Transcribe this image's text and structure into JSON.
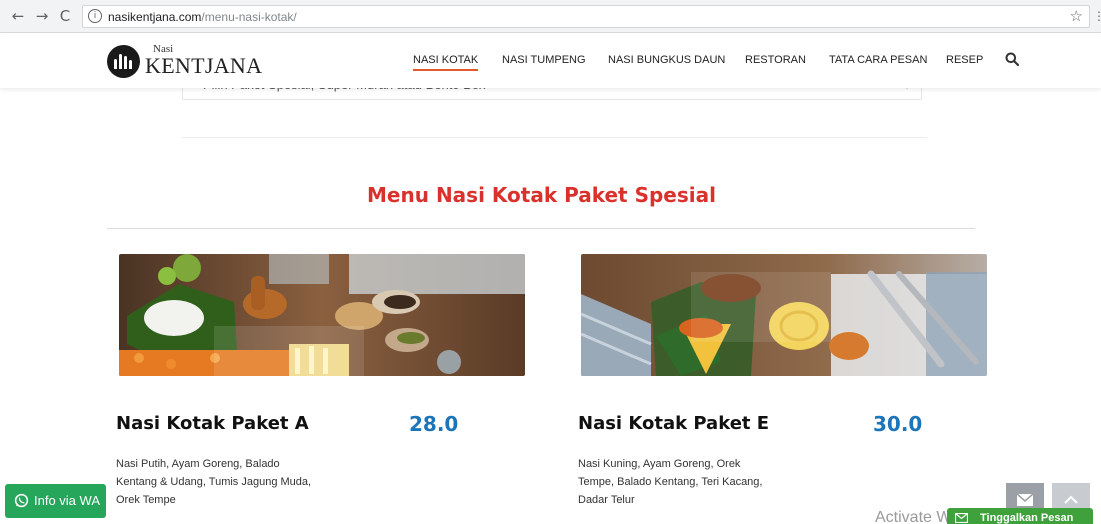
{
  "browser": {
    "url_domain": "nasikentjana.com",
    "url_path": "/menu-nasi-kotak/",
    "back_icon": "←",
    "forward_icon": "→",
    "reload_icon": "C",
    "info_icon": "i",
    "star_icon": "☆",
    "menu_icon": "⋮"
  },
  "header": {
    "logo_small": "Nasi",
    "logo_big": "KENTJANA",
    "menu": [
      {
        "label": "NASI KOTAK",
        "active": true
      },
      {
        "label": "NASI TUMPENG"
      },
      {
        "label": "NASI BUNGKUS DAUN"
      },
      {
        "label": "RESTORAN"
      },
      {
        "label": "TATA CARA PESAN"
      },
      {
        "label": "RESEP"
      }
    ]
  },
  "accordion": {
    "label": "Pilih Paket Spesial, Super Murah atau Bento Box",
    "toggle": "+"
  },
  "section": {
    "title": "Menu Nasi Kotak Paket Spesial"
  },
  "products": [
    {
      "name": "Nasi Kotak Paket A",
      "price": "28.0",
      "desc_lines": [
        "Nasi Putih, Ayam Goreng, Balado",
        "Kentang & Udang, Tumis Jagung Muda,",
        "Orek Tempe"
      ]
    },
    {
      "name": "Nasi Kotak Paket E",
      "price": "30.0",
      "desc_lines": [
        "Nasi Kuning, Ayam Goreng, Orek",
        "Tempe, Balado Kentang, Teri Kacang,",
        "Dadar Telur"
      ]
    }
  ],
  "widgets": {
    "wa_label": "Info via WA",
    "activate_text": "Activate W",
    "leave_message": "Tinggalkan Pesan",
    "up_icon": "^"
  },
  "colors": {
    "accent_red": "#d9312b",
    "price_blue": "#1b75bb",
    "wa_green": "#26a65b",
    "chat_green": "#3fa13c"
  }
}
